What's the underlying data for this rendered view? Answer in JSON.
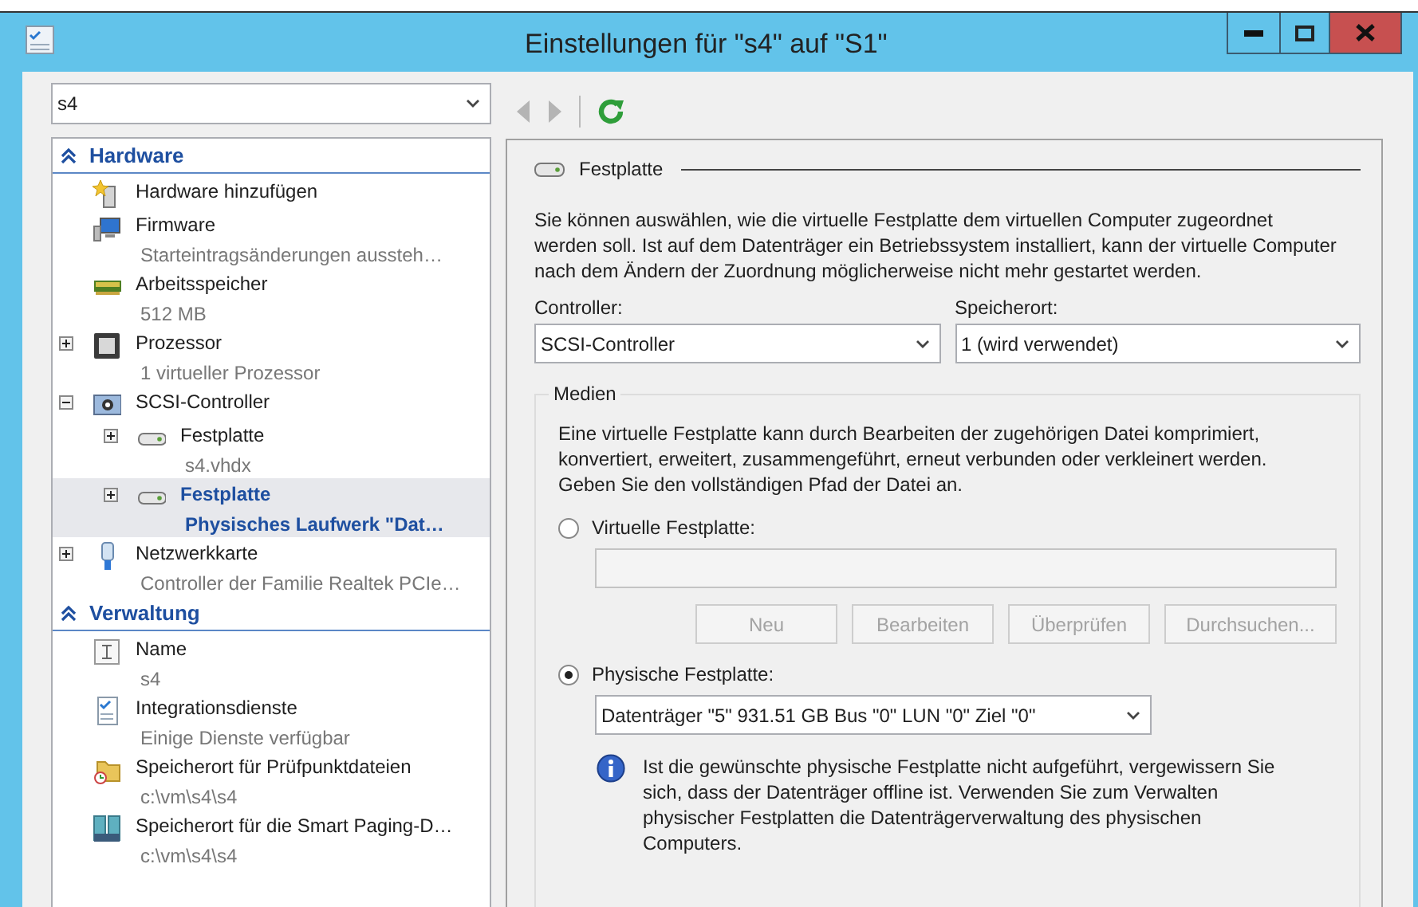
{
  "window": {
    "title": "Einstellungen für \"s4\" auf \"S1\""
  },
  "vm_selector": {
    "value": "s4"
  },
  "toolbar": [
    {
      "kind": "back",
      "disabled": true
    },
    {
      "kind": "forward",
      "disabled": true
    },
    {
      "kind": "refresh",
      "disabled": false
    }
  ],
  "tree": {
    "sections": [
      {
        "title": "Hardware",
        "expanded": true,
        "items": [
          {
            "kind": "add",
            "title": "Hardware hinzufügen",
            "selected": false
          },
          {
            "kind": "firmware",
            "title": "Firmware",
            "subtitle": "Starteintragsänderungen aussteh…",
            "selected": false
          },
          {
            "kind": "memory",
            "title": "Arbeitsspeicher",
            "subtitle": "512 MB",
            "selected": false
          },
          {
            "kind": "processor",
            "title": "Prozessor",
            "subtitle": "1 virtueller Prozessor",
            "selected": false,
            "expanded": false
          },
          {
            "kind": "controller",
            "title": "SCSI-Controller",
            "selected": false,
            "expanded": true,
            "children": [
              {
                "kind": "disk",
                "title": "Festplatte",
                "subtitle": "s4.vhdx",
                "selected": false,
                "expanded": false
              },
              {
                "kind": "disk",
                "title": "Festplatte",
                "subtitle": "Physisches Laufwerk \"Dat…",
                "selected": true,
                "expanded": false
              }
            ]
          },
          {
            "kind": "adapter",
            "title": "Netzwerkkarte",
            "subtitle": "Controller der Familie Realtek PCIe…",
            "selected": false,
            "expanded": false
          }
        ]
      },
      {
        "title": "Verwaltung",
        "expanded": true,
        "items": [
          {
            "kind": "name",
            "title": "Name",
            "subtitle": "s4",
            "selected": false
          },
          {
            "kind": "services",
            "title": "Integrationsdienste",
            "subtitle": "Einige Dienste verfügbar",
            "selected": false
          },
          {
            "kind": "folder",
            "title": "Speicherort für Prüfpunktdateien",
            "subtitle": "c:\\vm\\s4\\s4",
            "selected": false
          },
          {
            "kind": "paging",
            "title": "Speicherort für die Smart Paging-D…",
            "subtitle": "c:\\vm\\s4\\s4",
            "selected": false
          }
        ]
      }
    ]
  },
  "panel": {
    "title": "Festplatte",
    "description": "Sie können auswählen, wie die virtuelle Festplatte dem virtuellen Computer zugeordnet werden soll. Ist auf dem Datenträger ein Betriebssystem installiert, kann der virtuelle Computer nach dem Ändern der Zuordnung möglicherweise nicht mehr gestartet werden.",
    "selects": [
      {
        "label": "Controller:",
        "value": "SCSI-Controller"
      },
      {
        "label": "Speicherort:",
        "value": "1 (wird verwendet)"
      }
    ],
    "media": {
      "title": "Medien",
      "description": "Eine virtuelle Festplatte kann durch Bearbeiten der zugehörigen Datei komprimiert, konvertiert, erweitert, zusammengeführt, erneut verbunden oder verkleinert werden. Geben Sie den vollständigen Pfad der Datei an.",
      "options": [
        {
          "kind": "file",
          "label": "Virtuelle Festplatte:",
          "selected": false,
          "buttons": [
            {
              "label": "Neu",
              "disabled": true
            },
            {
              "label": "Bearbeiten",
              "disabled": true
            },
            {
              "label": "Überprüfen",
              "disabled": true
            },
            {
              "label": "Durchsuchen...",
              "disabled": true
            }
          ]
        },
        {
          "kind": "disk",
          "label": "Physische Festplatte:",
          "selected": true,
          "value": "Datenträger \"5\" 931.51 GB Bus \"0\" LUN \"0\" Ziel \"0\"",
          "info": "Ist die gewünschte physische Festplatte nicht aufgeführt, vergewissern Sie sich, dass der Datenträger offline ist. Verwenden Sie zum Verwalten physischer Festplatten die Datenträgerverwaltung des physischen Computers."
        }
      ]
    }
  }
}
